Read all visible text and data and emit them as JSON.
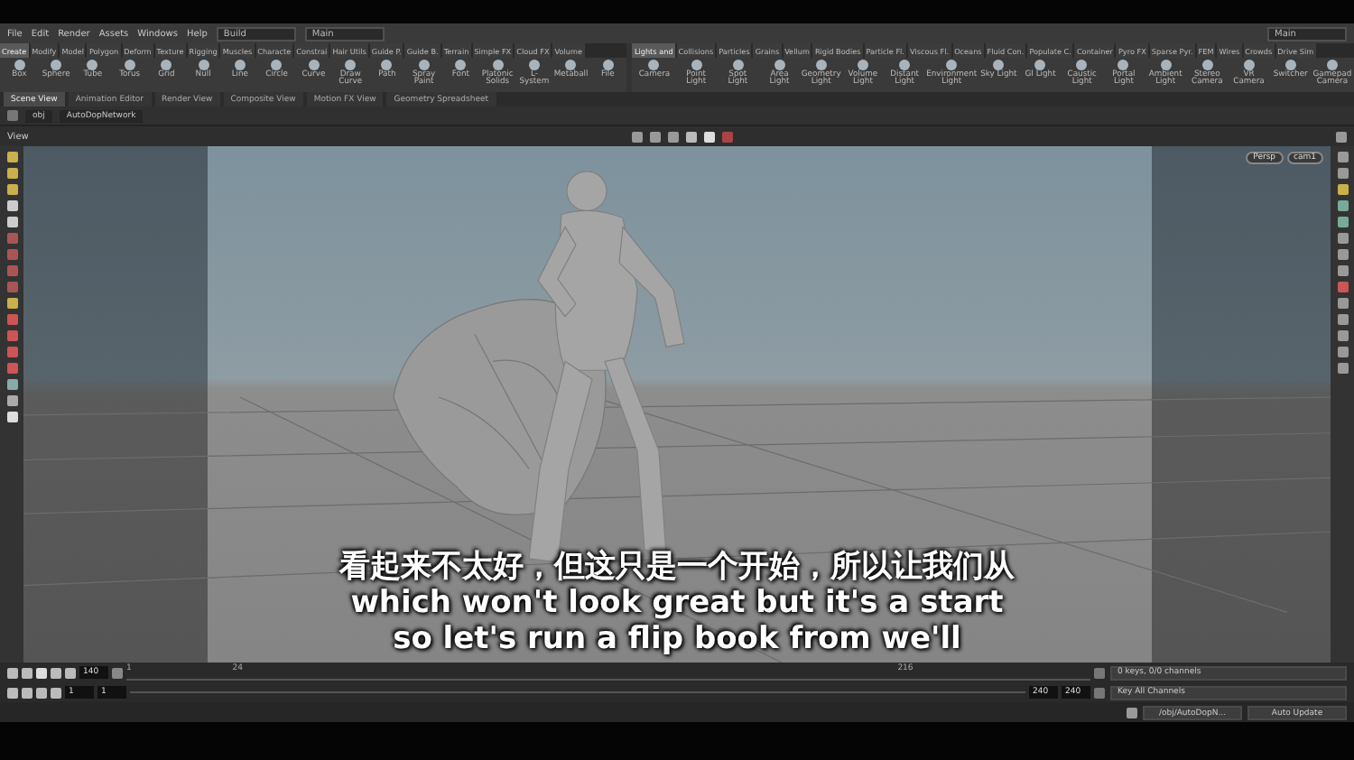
{
  "menu_bar": {
    "menus": [
      "File",
      "Edit",
      "Render",
      "Assets",
      "Windows",
      "Help"
    ],
    "desktop": "Build",
    "context": "Main",
    "right_context": "Main"
  },
  "shelf": {
    "tabs_left": [
      {
        "label": "Create",
        "selected": true
      },
      {
        "label": "Modify",
        "selected": false
      },
      {
        "label": "Model",
        "selected": false
      },
      {
        "label": "Polygon",
        "selected": false
      },
      {
        "label": "Deform",
        "selected": false
      },
      {
        "label": "Texture",
        "selected": false
      },
      {
        "label": "Rigging",
        "selected": false
      },
      {
        "label": "Muscles",
        "selected": false
      },
      {
        "label": "Characte",
        "selected": false
      },
      {
        "label": "Constrai",
        "selected": false
      },
      {
        "label": "Hair Utils",
        "selected": false
      },
      {
        "label": "Guide P.",
        "selected": false
      },
      {
        "label": "Guide B.",
        "selected": false
      },
      {
        "label": "Terrain",
        "selected": false
      },
      {
        "label": "Simple FX",
        "selected": false
      },
      {
        "label": "Cloud FX",
        "selected": false
      },
      {
        "label": "Volume",
        "selected": false
      }
    ],
    "tabs_right": [
      {
        "label": "Lights and",
        "selected": true
      },
      {
        "label": "Collisions",
        "selected": false
      },
      {
        "label": "Particles",
        "selected": false
      },
      {
        "label": "Grains",
        "selected": false
      },
      {
        "label": "Vellum",
        "selected": false
      },
      {
        "label": "Rigid Bodies",
        "selected": false
      },
      {
        "label": "Particle Fl.",
        "selected": false
      },
      {
        "label": "Viscous Fl.",
        "selected": false
      },
      {
        "label": "Oceans",
        "selected": false
      },
      {
        "label": "Fluid Con.",
        "selected": false
      },
      {
        "label": "Populate C.",
        "selected": false
      },
      {
        "label": "Container",
        "selected": false
      },
      {
        "label": "Pyro FX",
        "selected": false
      },
      {
        "label": "Sparse Pyr.",
        "selected": false
      },
      {
        "label": "FEM",
        "selected": false
      },
      {
        "label": "Wires",
        "selected": false
      },
      {
        "label": "Crowds",
        "selected": false
      },
      {
        "label": "Drive Sim",
        "selected": false
      }
    ],
    "tools_left": [
      "Box",
      "Sphere",
      "Tube",
      "Torus",
      "Grid",
      "Null",
      "Line",
      "Circle",
      "Curve",
      "Draw Curve",
      "Path",
      "Spray Paint",
      "Font",
      "Platonic Solids",
      "L-System",
      "Metaball",
      "File"
    ],
    "tools_right": [
      "Camera",
      "Point Light",
      "Spot Light",
      "Area Light",
      "Geometry Light",
      "Volume Light",
      "Distant Light",
      "Environment Light",
      "Sky Light",
      "GI Light",
      "Caustic Light",
      "Portal Light",
      "Ambient Light",
      "Stereo Camera",
      "VR Camera",
      "Switcher",
      "Gamepad Camera"
    ]
  },
  "pane_tabs": [
    {
      "label": "Scene View",
      "selected": true
    },
    {
      "label": "Animation Editor",
      "selected": false
    },
    {
      "label": "Render View",
      "selected": false
    },
    {
      "label": "Composite View",
      "selected": false
    },
    {
      "label": "Motion FX View",
      "selected": false
    },
    {
      "label": "Geometry Spreadsheet",
      "selected": false
    }
  ],
  "path_bar": [
    "obj",
    "AutoDopNetwork"
  ],
  "viewer": {
    "title": "View",
    "camera_buttons": [
      "Persp",
      "cam1"
    ]
  },
  "timeline": {
    "frame": "140",
    "tick_labels": [
      "1",
      "24",
      "216"
    ],
    "start": "1",
    "range_start": "1",
    "range_end": "240",
    "end": "240",
    "keys": "0 keys, 0/0 channels",
    "key_all": "Key All Channels",
    "network": "/obj/AutoDopN...",
    "update": "Auto Update"
  },
  "subtitles": [
    "看起来不太好，但这只是一个开始，所以让我们从",
    "which won't look great but it's a start",
    "so let's run a flip book from we'll"
  ]
}
